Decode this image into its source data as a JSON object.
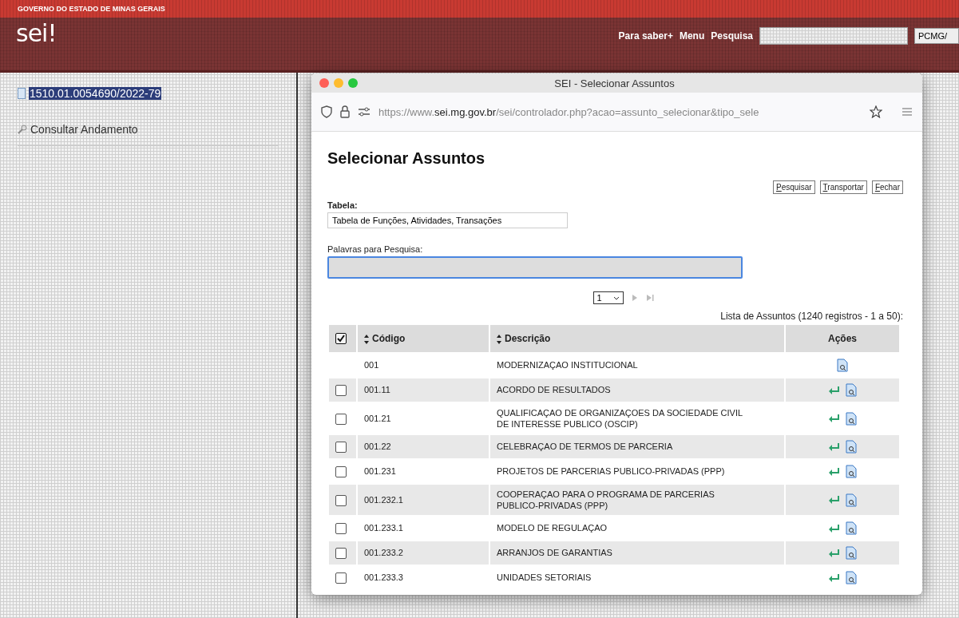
{
  "header": {
    "government": "GOVERNO DO ESTADO DE MINAS GERAIS",
    "logo": "sei!",
    "links": [
      "Para saber+",
      "Menu",
      "Pesquisa"
    ],
    "unit_select": "PCMG/"
  },
  "sidebar": {
    "process": {
      "label": "1510.01.0054690/2022-79",
      "selected": true
    },
    "items": [
      "Consultar Andamento"
    ]
  },
  "dialog": {
    "title": "SEI - Selecionar Assuntos",
    "url": {
      "prefix": "https://www.",
      "domain": "sei.mg.gov.br",
      "rest": "/sei/controlador.php?acao=assunto_selecionar&tipo_sele"
    },
    "heading": "Selecionar Assuntos",
    "buttons": [
      {
        "accesskey": "P",
        "rest": "esquisar"
      },
      {
        "accesskey": "T",
        "rest": "ransportar"
      },
      {
        "accesskey": "F",
        "rest": "echar"
      }
    ],
    "table_label": "Tabela:",
    "table_value": "Tabela de Funções, Atividades, Transações",
    "search_label": "Palavras para Pesquisa:",
    "page": "1",
    "list_caption": "Lista de Assuntos (1240 registros - 1 a 50):",
    "columns": {
      "select_all_checked": true,
      "code": "Código",
      "description": "Descrição",
      "actions": "Ações"
    },
    "rows": [
      {
        "code": "001",
        "description": "MODERNIZAÇAO INSTITUCIONAL",
        "selectable": false
      },
      {
        "code": "001.11",
        "description": "ACORDO DE RESULTADOS",
        "selectable": true,
        "checked": false
      },
      {
        "code": "001.21",
        "description": "QUALIFICAÇAO DE ORGANIZAÇOES DA SOCIEDADE CIVIL DE INTERESSE PUBLICO (OSCIP)",
        "selectable": true,
        "checked": false
      },
      {
        "code": "001.22",
        "description": "CELEBRAÇAO DE TERMOS DE PARCERIA",
        "selectable": true,
        "checked": false
      },
      {
        "code": "001.231",
        "description": "PROJETOS DE PARCERIAS PUBLICO-PRIVADAS (PPP)",
        "selectable": true,
        "checked": false
      },
      {
        "code": "001.232.1",
        "description": "COOPERAÇAO PARA O PROGRAMA DE PARCERIAS PUBLICO-PRIVADAS (PPP)",
        "selectable": true,
        "checked": false
      },
      {
        "code": "001.233.1",
        "description": "MODELO DE REGULAÇAO",
        "selectable": true,
        "checked": false
      },
      {
        "code": "001.233.2",
        "description": "ARRANJOS DE GARANTIAS",
        "selectable": true,
        "checked": false
      },
      {
        "code": "001.233.3",
        "description": "UNIDADES SETORIAIS",
        "selectable": true,
        "checked": false
      }
    ]
  }
}
